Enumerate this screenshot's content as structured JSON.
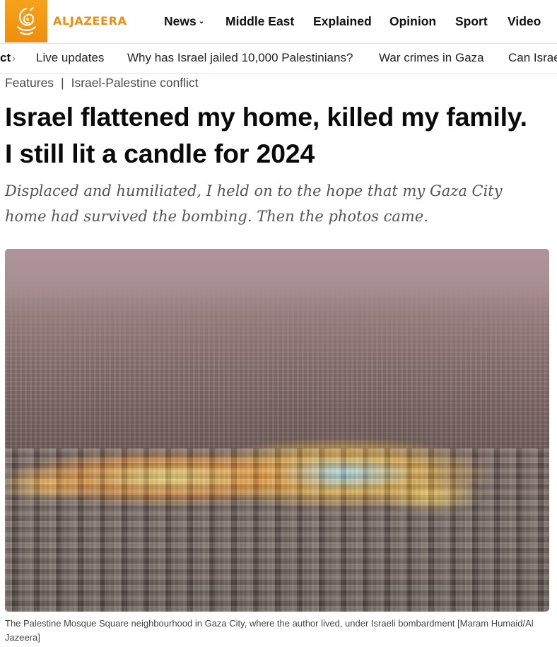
{
  "brand": {
    "name": "ALJAZEERA",
    "logo_icon": "aljazeera-calligraphy-logo",
    "accent_color": "#F7A21B"
  },
  "nav": {
    "items": [
      {
        "label": "News",
        "has_dropdown": true
      },
      {
        "label": "Middle East"
      },
      {
        "label": "Explained"
      },
      {
        "label": "Opinion"
      },
      {
        "label": "Sport"
      },
      {
        "label": "Video"
      }
    ]
  },
  "subnav": {
    "current": "ct",
    "items": [
      {
        "label": "Live updates"
      },
      {
        "label": "Why has Israel jailed 10,000 Palestinians?"
      },
      {
        "label": "War crimes in Gaza"
      },
      {
        "label": "Can Israe"
      }
    ]
  },
  "breadcrumb": {
    "section": "Features",
    "separator": "|",
    "topic": "Israel-Palestine conflict"
  },
  "article": {
    "title_line1": "Israel flattened my home, killed my family.",
    "title_line2": "I still lit a candle for 2024",
    "standfirst_line1": "Displaced and humiliated, I held on to the hope that my Gaza City",
    "standfirst_line2": "home had survived the bombing. Then the photos came.",
    "caption": "The Palestine Mosque Square neighbourhood in Gaza City, where the author lived, under Israeli bombardment [Maram Humaid/Al Jazeera]"
  }
}
